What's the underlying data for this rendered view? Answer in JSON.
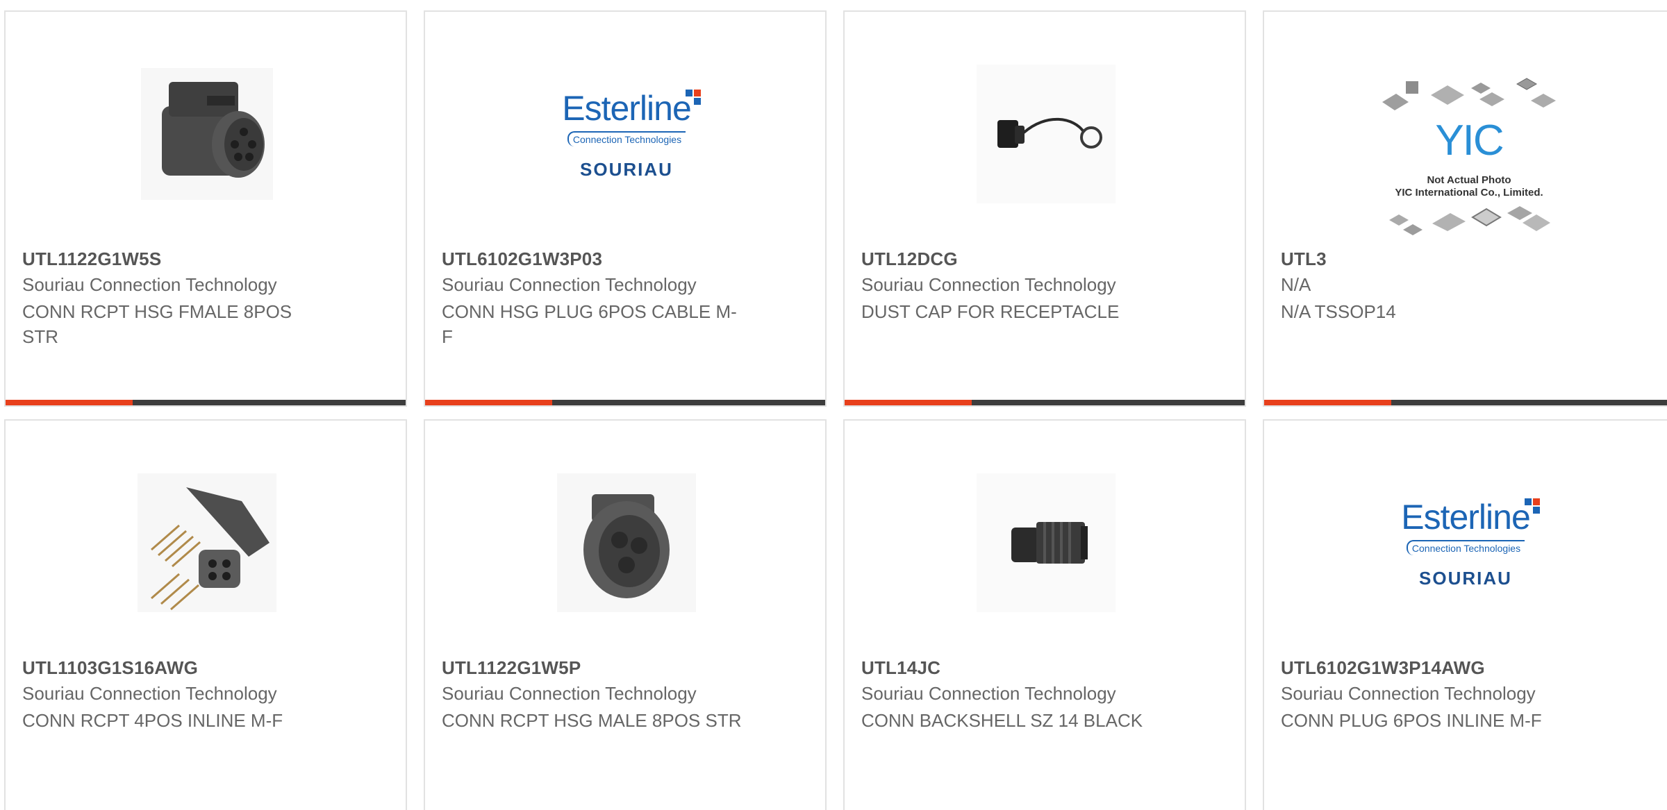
{
  "products": [
    {
      "part_number": "UTL1122G1W5S",
      "manufacturer": "Souriau Connection Technology",
      "description": "CONN RCPT HSG FMALE 8POS STR",
      "image": "connector-receptacle-female-icon"
    },
    {
      "part_number": "UTL6102G1W3P03",
      "manufacturer": "Souriau Connection Technology",
      "description": "CONN HSG PLUG 6POS CABLE M-F",
      "image": "esterline-souriau-logo"
    },
    {
      "part_number": "UTL12DCG",
      "manufacturer": "Souriau Connection Technology",
      "description": "DUST CAP FOR RECEPTACLE",
      "image": "dust-cap-icon"
    },
    {
      "part_number": "UTL3",
      "manufacturer": "N/A",
      "description": "N/A TSSOP14",
      "image": "yic-not-actual-photo-placeholder"
    },
    {
      "part_number": "UTL1103G1S16AWG",
      "manufacturer": "Souriau Connection Technology",
      "description": "CONN RCPT 4POS INLINE M-F",
      "image": "connector-kit-with-pins-icon"
    },
    {
      "part_number": "UTL1122G1W5P",
      "manufacturer": "Souriau Connection Technology",
      "description": "CONN RCPT HSG MALE 8POS STR",
      "image": "connector-receptacle-male-icon"
    },
    {
      "part_number": "UTL14JC",
      "manufacturer": "Souriau Connection Technology",
      "description": "CONN BACKSHELL SZ 14 BLACK",
      "image": "backshell-icon"
    },
    {
      "part_number": "UTL6102G1W3P14AWG",
      "manufacturer": "Souriau Connection Technology",
      "description": "CONN PLUG 6POS INLINE M-F",
      "image": "esterline-souriau-logo"
    }
  ],
  "logo": {
    "esterline_word": "Esterline",
    "esterline_sub": "Connection Technologies",
    "souriau_word": "SOURIAU"
  },
  "yic": {
    "mark": "YIC",
    "note_line1": "Not Actual Photo",
    "note_line2": "YIC International Co., Limited."
  },
  "colors": {
    "accent": "#e8401c",
    "bar_dark": "#3d3d3d",
    "card_border": "#e2e2e2",
    "text": "#666666",
    "logo_blue": "#1c65b5"
  }
}
